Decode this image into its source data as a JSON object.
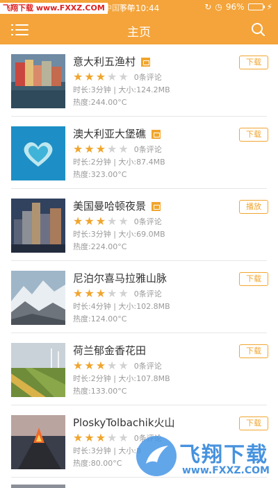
{
  "status_bar": {
    "watermark_a": "飞翔下载",
    "watermark_b": "www.FXXZ.COM",
    "carrier": "中国移动",
    "time": "下午10:44",
    "battery": "96%",
    "battery_level": 0.96
  },
  "nav": {
    "title": "主页",
    "menu_icon": "menu-list-icon",
    "search_icon": "search-icon"
  },
  "colors": {
    "accent": "#f4a43a",
    "star_on": "#f0a52e",
    "star_off": "#d2d2d2"
  },
  "items": [
    {
      "name": "意大利五渔村",
      "badge": true,
      "rating": 3,
      "reviews": "0条评论",
      "meta": "时长:3分钟 | 大小:124.2MB",
      "heat": "热度:244.00°C",
      "action": "下载"
    },
    {
      "name": "澳大利亚大堡礁",
      "badge": true,
      "rating": 3,
      "reviews": "0条评论",
      "meta": "时长:2分钟 | 大小:87.4MB",
      "heat": "热度:323.00°C",
      "action": "下载"
    },
    {
      "name": "美国曼哈顿夜景",
      "badge": true,
      "rating": 3,
      "reviews": "0条评论",
      "meta": "时长:3分钟 | 大小:69.0MB",
      "heat": "热度:224.00°C",
      "action": "播放"
    },
    {
      "name": "尼泊尔喜马拉雅山脉",
      "badge": false,
      "rating": 3,
      "reviews": "0条评论",
      "meta": "时长:4分钟 | 大小:102.8MB",
      "heat": "热度:124.00°C",
      "action": "下载"
    },
    {
      "name": "荷兰郁金香花田",
      "badge": false,
      "rating": 3,
      "reviews": "0条评论",
      "meta": "时长:2分钟 | 大小:107.8MB",
      "heat": "热度:133.00°C",
      "action": "下载"
    },
    {
      "name": "PloskyTolbachik火山",
      "badge": false,
      "rating": 3,
      "reviews": "0条评论",
      "meta": "时长:3分钟 | 大小:8",
      "heat": "热度:80.00°C",
      "action": "下载"
    }
  ],
  "big_watermark": {
    "title": "飞翔下载",
    "url": "www.FXXZ.COM"
  }
}
